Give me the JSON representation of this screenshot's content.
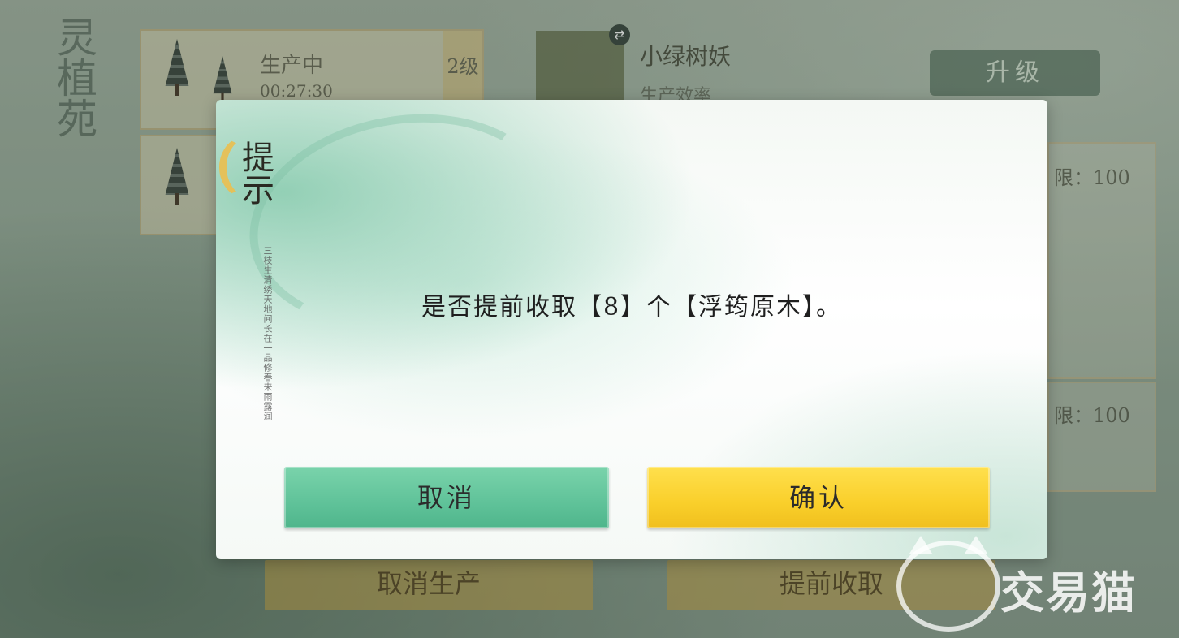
{
  "background": {
    "side_title": "灵植苑",
    "slot1": {
      "status": "生产中",
      "timer": "00:27:30",
      "level": "2级"
    },
    "creature": {
      "name": "小绿树妖",
      "subtitle": "生产效率"
    },
    "upgrade_label": "升级",
    "limit1": "限：100",
    "limit2": "限：100",
    "cancel_production_label": "取消生产",
    "collect_early_label": "提前收取"
  },
  "dialog": {
    "title": "提示",
    "calligraphy": "三枝生清绣天地间长在一品修春来雨露润",
    "message": "是否提前收取【8】个【浮筠原木】。",
    "cancel_label": "取消",
    "confirm_label": "确认"
  },
  "watermark": {
    "text": "交易猫"
  },
  "colors": {
    "cancel_button": "#5fc299",
    "confirm_button": "#f9cf2a",
    "upgrade_button": "#46644f"
  }
}
